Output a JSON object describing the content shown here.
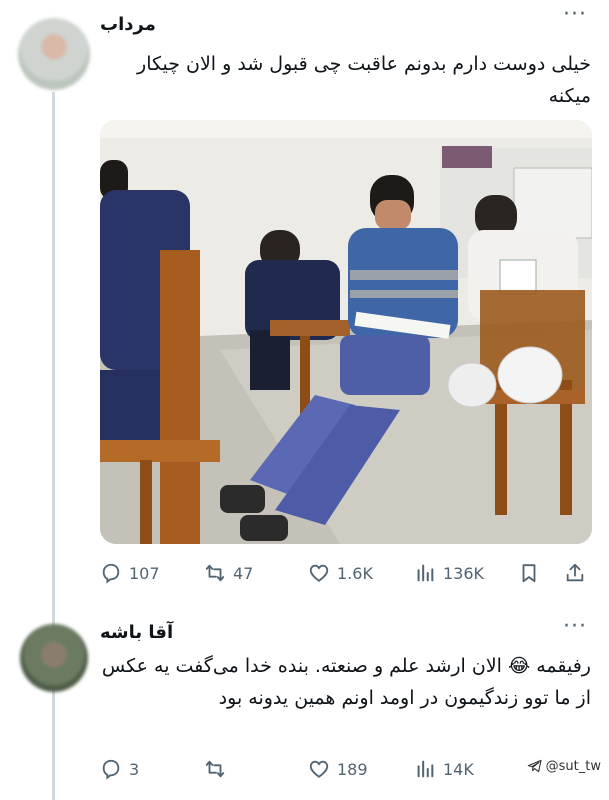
{
  "tweet1": {
    "author_name": "مرداب",
    "more": "···",
    "text": "خیلی دوست دارم بدونم عاقبت چی قبول شد و الان چیکار میکنه",
    "stats": {
      "replies": "107",
      "retweets": "47",
      "likes": "1.6K",
      "views": "136K"
    }
  },
  "tweet2": {
    "author_name": "آقا باشه",
    "more": "···",
    "text": "رفیقمه 😂 الان ارشد علم و صنعته. بنده خدا می‌گفت یه عکس از ما توو زندگیمون در اومد اونم همین یدونه بود",
    "stats": {
      "replies": "3",
      "likes": "189",
      "views": "14K"
    }
  },
  "watermark": "@sut_tw",
  "colors": {
    "icon": "#536471",
    "thread_line": "#cfd9de",
    "text": "#0f1419"
  }
}
